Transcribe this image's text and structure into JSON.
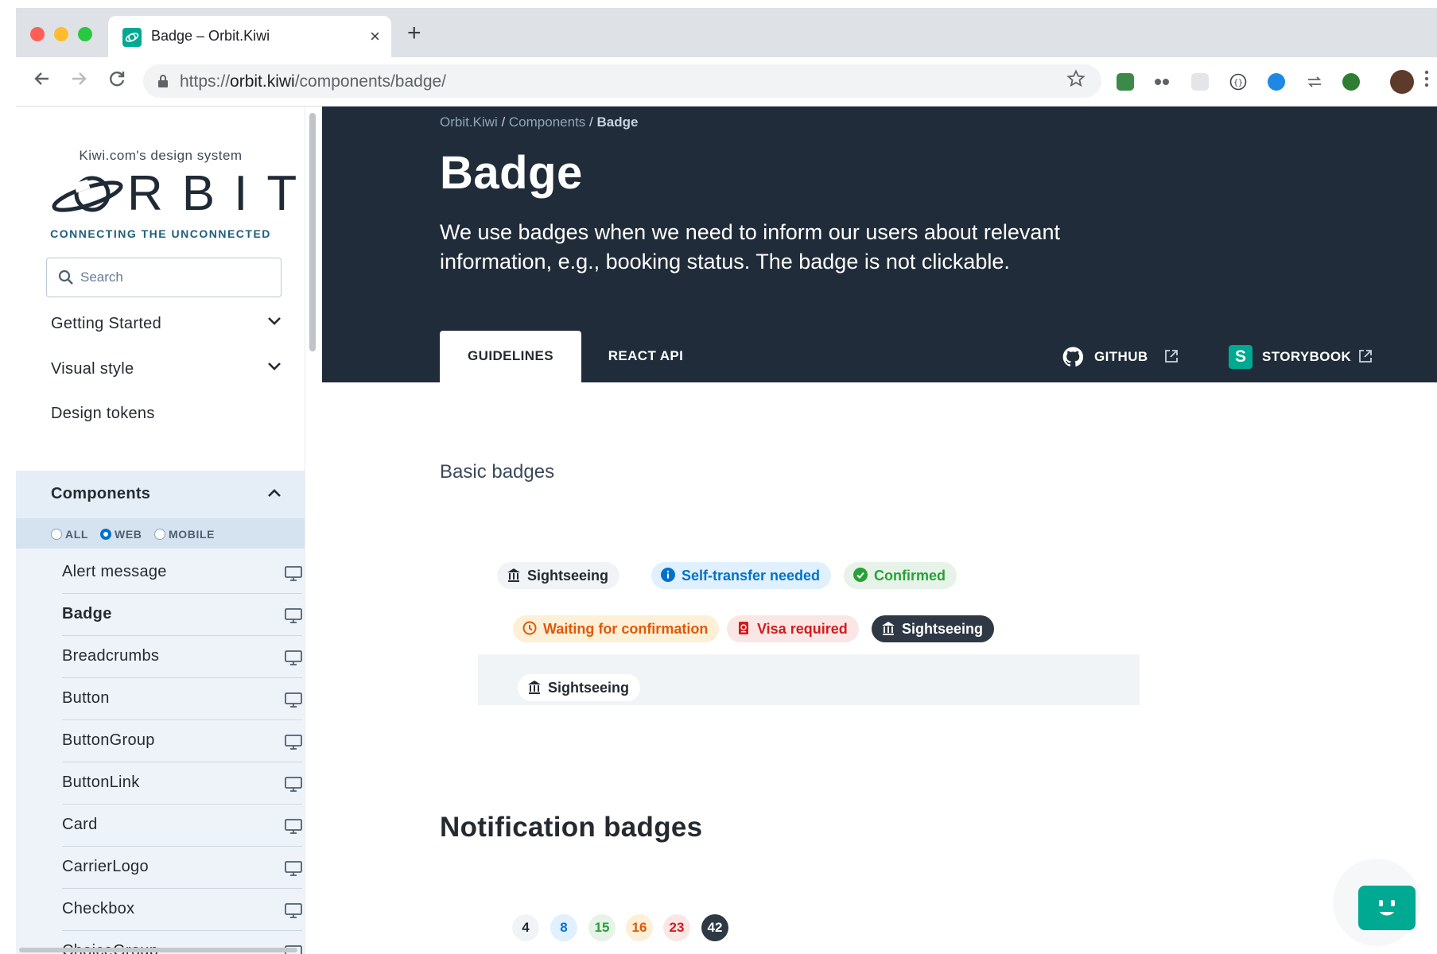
{
  "browser": {
    "tab_title": "Badge – Orbit.Kiwi",
    "tab_close": "×",
    "new_tab": "+",
    "url_scheme": "https://",
    "url_host": "orbit.kiwi",
    "url_path": "/components/badge/",
    "icons": [
      "back-arrow-icon",
      "forward-arrow-icon",
      "reload-icon",
      "lock-icon",
      "bookmark-star-icon",
      "kebab-menu-icon"
    ]
  },
  "sidebar": {
    "tagline": "Kiwi.com's design system",
    "logo_text": "RBIT",
    "subtitle": "CONNECTING THE UNCONNECTED",
    "search_placeholder": "Search",
    "nav": [
      {
        "label": "Getting Started",
        "expandable": true
      },
      {
        "label": "Visual style",
        "expandable": true
      },
      {
        "label": "Design tokens",
        "expandable": false
      },
      {
        "label": "Components",
        "expandable": true,
        "expanded": true
      }
    ],
    "filters": [
      {
        "label": "ALL",
        "selected": false
      },
      {
        "label": "WEB",
        "selected": true
      },
      {
        "label": "MOBILE",
        "selected": false
      }
    ],
    "components": [
      "Alert message",
      "Badge",
      "Breadcrumbs",
      "Button",
      "ButtonGroup",
      "ButtonLink",
      "Card",
      "CarrierLogo",
      "Checkbox",
      "ChoiceGroup"
    ],
    "active_component": "Badge"
  },
  "hero": {
    "breadcrumb": [
      "Orbit.Kiwi",
      "Components",
      "Badge"
    ],
    "breadcrumb_sep": " / ",
    "title": "Badge",
    "description": "We use badges when we need to inform our users about relevant information, e.g., booking status. The badge is not clickable.",
    "tabs": [
      {
        "label": "GUIDELINES",
        "active": true
      },
      {
        "label": "REACT API",
        "active": false
      }
    ],
    "links": [
      {
        "label": "GITHUB",
        "icon": "github-icon"
      },
      {
        "label": "STORYBOOK",
        "icon": "storybook-icon",
        "icon_letter": "S"
      }
    ]
  },
  "content": {
    "basic_heading": "Basic badges",
    "badges": [
      {
        "label": "Sightseeing",
        "type": "neutral",
        "icon": "landmark-icon"
      },
      {
        "label": "Self-transfer needed",
        "type": "info",
        "icon": "info-icon"
      },
      {
        "label": "Confirmed",
        "type": "success",
        "icon": "check-circle-icon"
      },
      {
        "label": "Waiting for confirmation",
        "type": "warning",
        "icon": "clock-icon"
      },
      {
        "label": "Visa required",
        "type": "critical",
        "icon": "passport-icon"
      },
      {
        "label": "Sightseeing",
        "type": "dark",
        "icon": "landmark-icon"
      },
      {
        "label": "Sightseeing",
        "type": "white",
        "icon": "landmark-icon"
      }
    ],
    "notification_heading": "Notification badges",
    "notification_badges": [
      {
        "value": "4",
        "type": "neutral"
      },
      {
        "value": "8",
        "type": "info"
      },
      {
        "value": "15",
        "type": "success"
      },
      {
        "value": "16",
        "type": "warning"
      },
      {
        "value": "23",
        "type": "critical"
      },
      {
        "value": "42",
        "type": "dark"
      }
    ]
  },
  "colors": {
    "hero_bg": "#202c39",
    "brand": "#00a991",
    "info": "#0172cb",
    "success": "#28a138",
    "warning": "#e2580a",
    "critical": "#d21c1c"
  }
}
